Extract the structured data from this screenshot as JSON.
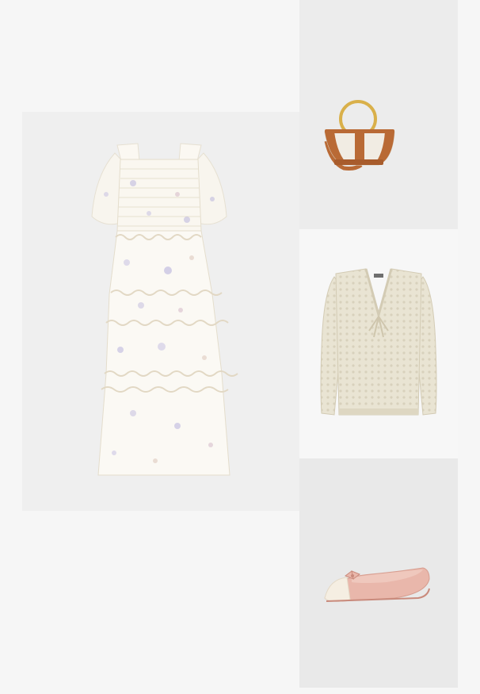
{
  "outfit_grid": {
    "items": [
      {
        "icon": "floral-tiered-maxi-dress-image"
      },
      {
        "icon": "leather-ring-handle-tote-bag-image"
      },
      {
        "icon": "crochet-tie-front-cardigan-image"
      },
      {
        "icon": "pink-bow-ballet-flat-image"
      }
    ]
  },
  "colors": {
    "page_background": "#f6f6f6",
    "dress_tile": "#efefef",
    "bag_tile": "#ececec",
    "cardigan_tile": "#f7f7f7",
    "shoes_tile": "#e9e9e9",
    "bag_leather": "#b96a35",
    "bag_canvas": "#f1ece3",
    "bag_ring": "#d9b04a",
    "cardigan_knit": "#e9e4d3",
    "shoe_pink": "#e9b7ab",
    "dress_ivory": "#fbf9f4"
  }
}
